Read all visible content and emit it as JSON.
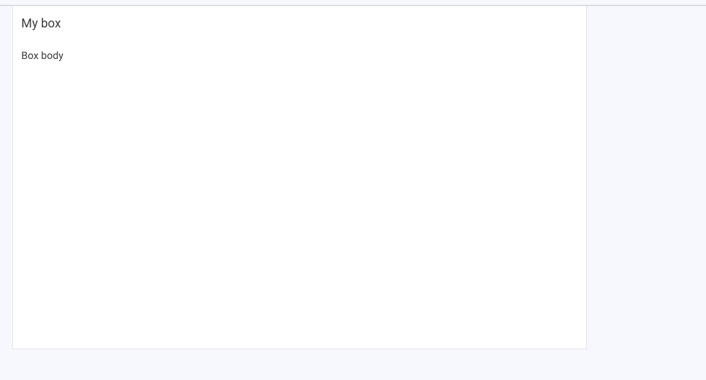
{
  "box": {
    "title": "My box",
    "body": "Box body"
  }
}
